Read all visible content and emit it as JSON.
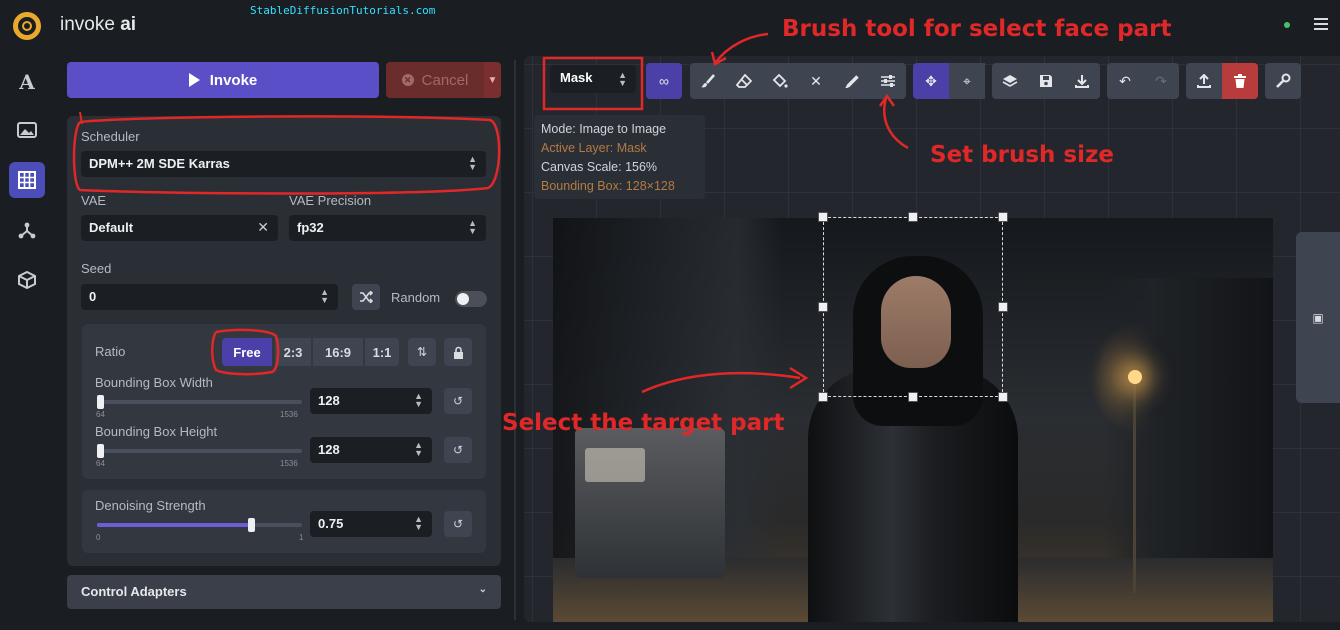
{
  "app": {
    "title_prefix": "invoke",
    "title_suffix": "ai",
    "watermark": "StableDiffusionTutorials.com"
  },
  "sidebar": {
    "items": [
      {
        "icon": "text-icon",
        "glyph": "A"
      },
      {
        "icon": "image-icon",
        "glyph": "▣"
      },
      {
        "icon": "grid-icon",
        "glyph": "▦"
      },
      {
        "icon": "nodes-icon",
        "glyph": "⅄"
      },
      {
        "icon": "cube-icon",
        "glyph": "⬡"
      }
    ]
  },
  "actions": {
    "invoke_label": "Invoke",
    "cancel_label": "Cancel"
  },
  "settings": {
    "scheduler_label": "Scheduler",
    "scheduler_value": "DPM++ 2M SDE Karras",
    "vae_label": "VAE",
    "vae_value": "Default",
    "vae_precision_label": "VAE Precision",
    "vae_precision_value": "fp32",
    "seed_label": "Seed",
    "seed_value": "0",
    "random_label": "Random",
    "random_enabled": false,
    "ratio_label": "Ratio",
    "ratio_options": [
      "Free",
      "2:3",
      "16:9",
      "1:1"
    ],
    "ratio_selected": "Free",
    "bbox_width_label": "Bounding Box Width",
    "bbox_width_value": "128",
    "bbox_width_min": "64",
    "bbox_width_max": "1536",
    "bbox_height_label": "Bounding Box Height",
    "bbox_height_value": "128",
    "bbox_height_min": "64",
    "bbox_height_max": "1536",
    "denoise_label": "Denoising Strength",
    "denoise_value": "0.75",
    "denoise_min": "0",
    "denoise_max": "1",
    "denoise_fraction": 0.75,
    "bbox_width_fraction": 0.0,
    "bbox_height_fraction": 0.0
  },
  "control_adapters": {
    "label": "Control Adapters"
  },
  "canvas": {
    "layer_select": "Mask",
    "status": {
      "mode": "Mode: Image to Image",
      "active_layer": "Active Layer: Mask",
      "canvas_scale": "Canvas Scale: 156%",
      "bounding_box": "Bounding Box: 128×128"
    }
  },
  "annotations": {
    "brush_tool": "Brush tool for select face part",
    "brush_size": "Set brush size",
    "target_part": "Select the target part"
  },
  "colors": {
    "accent": "#5b4fc7",
    "cancel": "#6b2c2c",
    "annotation": "#e02828",
    "status_orange": "#b57a44"
  }
}
